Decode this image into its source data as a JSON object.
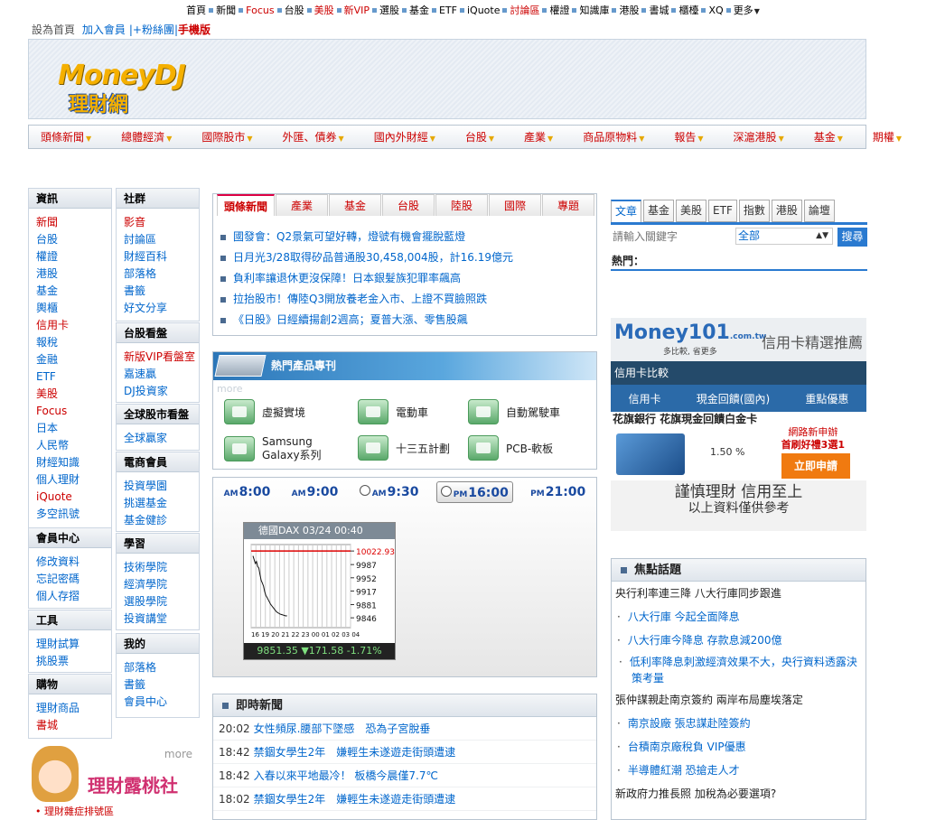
{
  "topnav": {
    "items": [
      "首頁",
      "新聞",
      "Focus",
      "台股",
      "美股",
      "新VIP",
      "選股",
      "基金",
      "ETF",
      "iQuote",
      "討論區",
      "權證",
      "知識庫",
      "港股",
      "書城",
      "櫃檯",
      "XQ",
      "更多"
    ],
    "red": [
      2,
      4,
      5,
      10
    ]
  },
  "subnav": {
    "home": "設為首頁",
    "join": "加入會員",
    "fans": "|+粉絲團|",
    "mobile": "手機版"
  },
  "logo": {
    "money": "MoneyDJ",
    "dj": "",
    "sub": "理財網"
  },
  "categories": [
    "頭條新聞",
    "總體經濟",
    "國際股市",
    "外匯、債券",
    "國內外財經",
    "台股",
    "產業",
    "商品原物料",
    "報告",
    "深滬港股",
    "基金",
    "期權"
  ],
  "left": {
    "info": {
      "title": "資訊",
      "items": [
        {
          "t": "新聞",
          "r": true
        },
        {
          "t": "台股"
        },
        {
          "t": "權證"
        },
        {
          "t": "港股"
        },
        {
          "t": "基金"
        },
        {
          "t": "輿櫃"
        },
        {
          "t": "信用卡",
          "r": true
        },
        {
          "t": "報稅"
        },
        {
          "t": "金融"
        },
        {
          "t": "ETF"
        },
        {
          "t": "美股",
          "r": true
        },
        {
          "t": "Focus",
          "r": true
        },
        {
          "t": "日本"
        },
        {
          "t": "人民幣"
        },
        {
          "t": "財經知識"
        },
        {
          "t": "個人理財"
        },
        {
          "t": "iQuote",
          "r": true
        },
        {
          "t": "多空訊號"
        }
      ]
    },
    "member": {
      "title": "會員中心",
      "items": [
        {
          "t": "修改資料"
        },
        {
          "t": "忘記密碼"
        },
        {
          "t": "個人存摺"
        }
      ]
    },
    "tools": {
      "title": "工具",
      "items": [
        {
          "t": "理財試算"
        },
        {
          "t": "挑股票"
        }
      ]
    },
    "shop": {
      "title": "購物",
      "items": [
        {
          "t": "理財商品"
        },
        {
          "t": "書城",
          "r": true
        }
      ]
    },
    "social": {
      "title": "社群",
      "items": [
        {
          "t": "影音",
          "r": true
        },
        {
          "t": "討論區"
        },
        {
          "t": "財經百科"
        },
        {
          "t": "部落格"
        },
        {
          "t": "書籤"
        },
        {
          "t": "好文分享"
        }
      ]
    },
    "tw": {
      "title": "台股看盤",
      "items": [
        {
          "t": "新版VIP看盤室",
          "r": true
        },
        {
          "t": "嘉速贏"
        },
        {
          "t": "DJ投資家"
        }
      ]
    },
    "global": {
      "title": "全球股市看盤",
      "items": [
        {
          "t": "全球贏家"
        }
      ]
    },
    "ec": {
      "title": "電商會員",
      "items": [
        {
          "t": "投資學園"
        },
        {
          "t": "挑選基金"
        },
        {
          "t": "基金健診"
        }
      ]
    },
    "learn": {
      "title": "學習",
      "items": [
        {
          "t": "技術學院"
        },
        {
          "t": "經濟學院"
        },
        {
          "t": "選股學院"
        },
        {
          "t": "投資講堂"
        }
      ]
    },
    "mine": {
      "title": "我的",
      "items": [
        {
          "t": "部落格"
        },
        {
          "t": "書籤"
        },
        {
          "t": "會員中心"
        }
      ]
    }
  },
  "mascot": {
    "more": "more",
    "title": "理財露桃社",
    "sub": "• 理財雜症排號區"
  },
  "news": {
    "tabs": [
      "頭條新聞",
      "產業",
      "基金",
      "台股",
      "陸股",
      "國際",
      "專題"
    ],
    "items": [
      "國發會：Q2景氣可望好轉，燈號有機會擺脫藍燈",
      "日月光3/28取得矽品普通股30,458,004股，計16.19億元",
      "負利率讓退休更沒保障！日本銀髮族犯罪率飆高",
      "拉抬股市！傳陸Q3開放養老金入市、上證不買臉照跌",
      "《日股》日經續揚創2週高；夏普大漲、零售股飆"
    ]
  },
  "products": {
    "title": "熱門產品專刊",
    "more": "more",
    "items": [
      "虛擬實境",
      "電動車",
      "自動駕駛車",
      "Samsung Galaxy系列",
      "十三五計劃",
      "PCB-軟板"
    ]
  },
  "market": {
    "times": [
      {
        "ap": "AM",
        "t": "8:00"
      },
      {
        "ap": "AM",
        "t": "9:00"
      },
      {
        "ap": "AM",
        "t": "9:30"
      },
      {
        "ap": "PM",
        "t": "16:00"
      },
      {
        "ap": "PM",
        "t": "21:00"
      }
    ],
    "chart": {
      "head": "德國DAX  03/24  00:40",
      "levels": [
        "10022.93",
        "9987",
        "9952",
        "9917",
        "9881",
        "9846"
      ],
      "foot": "9851.35  ▼171.58  -1.71%",
      "xlabels": "16 19 20 21 22 23 00 01 02 03 04"
    }
  },
  "chart_data": {
    "type": "line",
    "title": "德國DAX",
    "y_ticks": [
      10022.93,
      9987,
      9952,
      9917,
      9881,
      9846
    ],
    "ylim": [
      9820,
      10040
    ],
    "last": 9851.35,
    "change": -171.58,
    "change_pct": -1.71,
    "values": [
      10010,
      10000,
      9990,
      9995,
      9982,
      9978,
      9960,
      9945,
      9938,
      9930,
      9915,
      9905,
      9900,
      9894,
      9888,
      9882,
      9878,
      9874,
      9870,
      9866,
      9862,
      9860,
      9858,
      9856,
      9855,
      9854,
      9853,
      9852,
      9851,
      9851.35
    ]
  },
  "realtime": {
    "title": "即時新聞",
    "items": [
      {
        "t": "20:02",
        "h": "女性頻尿.腰部下墜感　恐為子宮脫垂"
      },
      {
        "t": "18:42",
        "h": "禁錮女學生2年　嫌輕生未遂遊走街頭遭逮"
      },
      {
        "t": "18:42",
        "h": "入春以來平地最冷！ 板橋今晨僅7.7℃"
      },
      {
        "t": "18:02",
        "h": "禁錮女學生2年　嫌輕生未遂遊走街頭遭逮"
      }
    ]
  },
  "search": {
    "tabs": [
      "文章",
      "基金",
      "美股",
      "ETF",
      "指數",
      "港股",
      "論壇"
    ],
    "placeholder": "請輸入關鍵字",
    "scope": "全部",
    "button": "搜尋",
    "hot": "熱門："
  },
  "money101": {
    "logo": "Money101",
    "domain": ".com.tw",
    "slogan": "多比較, 省更多",
    "title": "信用卡精選推薦",
    "bar": "信用卡比較",
    "tabs": [
      "信用卡",
      "現金回饋(國內)",
      "重點優惠"
    ],
    "card": "花旗銀行 花旗現金回饋白金卡",
    "rate": "1.50 %",
    "newtitle": "網路新申辦",
    "gift": "首刷好禮3選1",
    "apply": "立即申請",
    "foot1": "謹慎理財 信用至上",
    "foot2": "以上資料僅供參考"
  },
  "focus": {
    "title": "焦點話題",
    "rows": [
      {
        "k": "h",
        "t": "央行利率連三降 八大行庫同步跟進"
      },
      {
        "k": "s",
        "t": "八大行庫 今起全面降息"
      },
      {
        "k": "s",
        "t": "八大行庫今降息 存款息減200億"
      },
      {
        "k": "w",
        "t": "低利率降息刺激經濟效果不大，央行資料透露決策考量"
      },
      {
        "k": "h",
        "t": "張仲謀親赴南京簽約 兩岸布局塵埃落定"
      },
      {
        "k": "s",
        "t": "南京設廠 張忠謀赴陸簽約"
      },
      {
        "k": "s",
        "t": "台積南京廠稅負 VIP優惠"
      },
      {
        "k": "s",
        "t": "半導體紅潮 恐搶走人才"
      },
      {
        "k": "h",
        "t": "新政府力推長照 加稅為必要選項?"
      }
    ]
  }
}
